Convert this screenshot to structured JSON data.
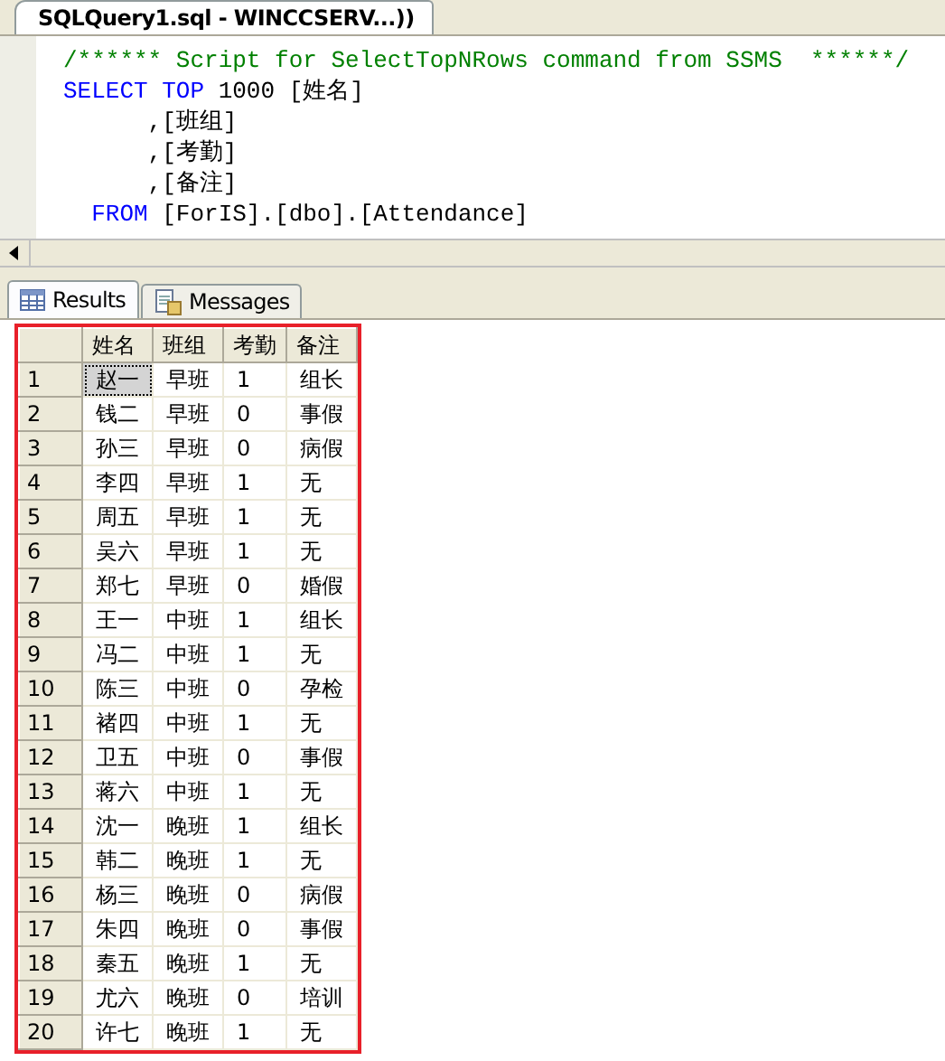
{
  "editor_tab": {
    "title": "SQLQuery1.sql - WINCCSERV...))",
    "selected": true
  },
  "code_lines": [
    {
      "tokens": [
        {
          "kind": "comment",
          "text": "/****** Script for SelectTopNRows command from SSMS  ******/"
        }
      ]
    },
    {
      "tokens": [
        {
          "kind": "keyword",
          "text": "SELECT"
        },
        {
          "kind": "keyword",
          "text": " TOP"
        },
        {
          "kind": "plain",
          "text": " 1000 [姓名]"
        }
      ]
    },
    {
      "tokens": [
        {
          "kind": "plain",
          "text": "      ,[班组]"
        }
      ]
    },
    {
      "tokens": [
        {
          "kind": "plain",
          "text": "      ,[考勤]"
        }
      ]
    },
    {
      "tokens": [
        {
          "kind": "plain",
          "text": "      ,[备注]"
        }
      ]
    },
    {
      "tokens": [
        {
          "kind": "keyword",
          "text": "  FROM"
        },
        {
          "kind": "plain",
          "text": " [ForIS].[dbo].[Attendance]"
        }
      ]
    }
  ],
  "result_tabs": [
    {
      "label": "Results",
      "kind": "grid",
      "selected": true
    },
    {
      "label": "Messages",
      "kind": "messages",
      "selected": false
    }
  ],
  "table": {
    "columns": [
      "姓名",
      "班组",
      "考勤",
      "备注"
    ],
    "rows": [
      {
        "number": "1",
        "cells": [
          "赵一",
          "早班",
          "1",
          "组长"
        ],
        "focused": true
      },
      {
        "number": "2",
        "cells": [
          "钱二",
          "早班",
          "0",
          "事假"
        ],
        "focused": false
      },
      {
        "number": "3",
        "cells": [
          "孙三",
          "早班",
          "0",
          "病假"
        ],
        "focused": false
      },
      {
        "number": "4",
        "cells": [
          "李四",
          "早班",
          "1",
          "无"
        ],
        "focused": false
      },
      {
        "number": "5",
        "cells": [
          "周五",
          "早班",
          "1",
          "无"
        ],
        "focused": false
      },
      {
        "number": "6",
        "cells": [
          "吴六",
          "早班",
          "1",
          "无"
        ],
        "focused": false
      },
      {
        "number": "7",
        "cells": [
          "郑七",
          "早班",
          "0",
          "婚假"
        ],
        "focused": false
      },
      {
        "number": "8",
        "cells": [
          "王一",
          "中班",
          "1",
          "组长"
        ],
        "focused": false
      },
      {
        "number": "9",
        "cells": [
          "冯二",
          "中班",
          "1",
          "无"
        ],
        "focused": false
      },
      {
        "number": "10",
        "cells": [
          "陈三",
          "中班",
          "0",
          "孕检"
        ],
        "focused": false
      },
      {
        "number": "11",
        "cells": [
          "褚四",
          "中班",
          "1",
          "无"
        ],
        "focused": false
      },
      {
        "number": "12",
        "cells": [
          "卫五",
          "中班",
          "0",
          "事假"
        ],
        "focused": false
      },
      {
        "number": "13",
        "cells": [
          "蒋六",
          "中班",
          "1",
          "无"
        ],
        "focused": false
      },
      {
        "number": "14",
        "cells": [
          "沈一",
          "晚班",
          "1",
          "组长"
        ],
        "focused": false
      },
      {
        "number": "15",
        "cells": [
          "韩二",
          "晚班",
          "1",
          "无"
        ],
        "focused": false
      },
      {
        "number": "16",
        "cells": [
          "杨三",
          "晚班",
          "0",
          "病假"
        ],
        "focused": false
      },
      {
        "number": "17",
        "cells": [
          "朱四",
          "晚班",
          "0",
          "事假"
        ],
        "focused": false
      },
      {
        "number": "18",
        "cells": [
          "秦五",
          "晚班",
          "1",
          "无"
        ],
        "focused": false
      },
      {
        "number": "19",
        "cells": [
          "尤六",
          "晚班",
          "0",
          "培训"
        ],
        "focused": false
      },
      {
        "number": "20",
        "cells": [
          "许七",
          "晚班",
          "1",
          "无"
        ],
        "focused": false
      }
    ]
  }
}
